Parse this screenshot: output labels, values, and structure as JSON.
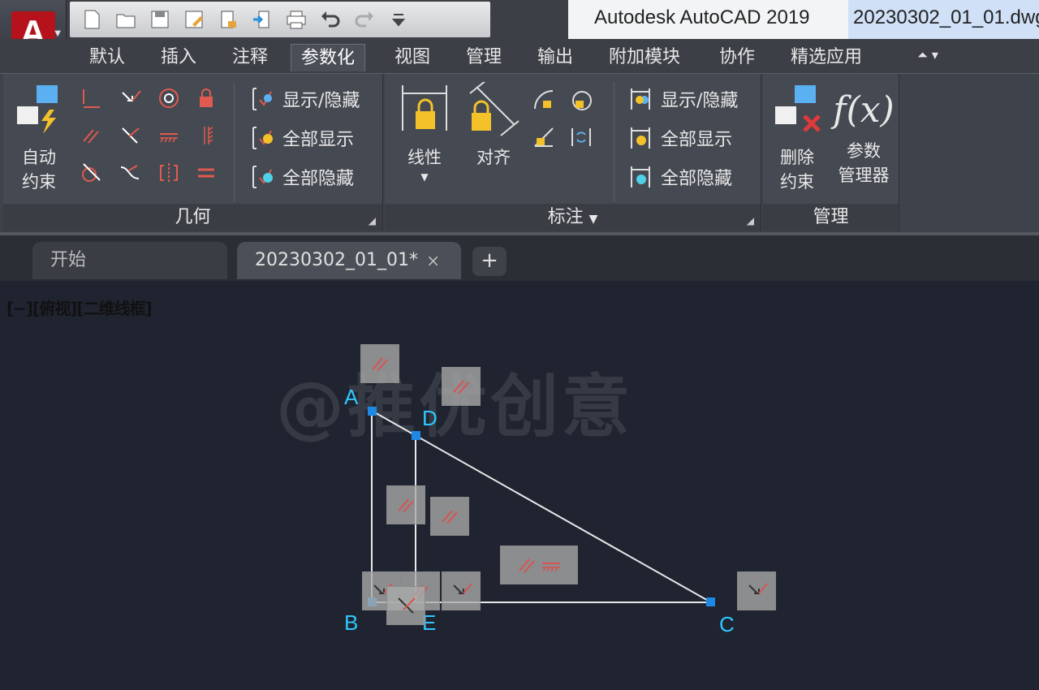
{
  "titlebar": {
    "app_title": "Autodesk AutoCAD 2019",
    "file_name": "20230302_01_01.dwg",
    "app_logo": "A"
  },
  "quick_access": [
    "new-icon",
    "open-icon",
    "save-icon",
    "save-as-icon",
    "open-from-cloud-icon",
    "share-icon",
    "plot-icon",
    "undo-icon",
    "redo-icon",
    "customize-qat-icon"
  ],
  "ribbon_tabs": [
    {
      "label": "默认"
    },
    {
      "label": "插入"
    },
    {
      "label": "注释"
    },
    {
      "label": "参数化",
      "active": true
    },
    {
      "label": "视图"
    },
    {
      "label": "管理"
    },
    {
      "label": "输出"
    },
    {
      "label": "附加模块"
    },
    {
      "label": "协作"
    },
    {
      "label": "精选应用"
    }
  ],
  "panels": {
    "geometry": {
      "title": "几何",
      "auto_constrain": [
        "自动",
        "约束"
      ],
      "show_hide": "显示/隐藏",
      "show_all": "全部显示",
      "hide_all": "全部隐藏"
    },
    "dimension": {
      "title": "标注",
      "linear": "线性",
      "aligned": "对齐",
      "show_hide": "显示/隐藏",
      "show_all": "全部显示",
      "hide_all": "全部隐藏"
    },
    "manage": {
      "title": "管理",
      "delete_constraints": [
        "删除",
        "约束"
      ],
      "parameters": [
        "参数",
        "管理器"
      ]
    }
  },
  "doc_tabs": {
    "start": "开始",
    "active": "20230302_01_01*",
    "close": "×",
    "new": "+"
  },
  "viewport": {
    "label": "[−][俯视][二维线框]"
  },
  "drawing": {
    "points": [
      "A",
      "B",
      "C",
      "D",
      "E"
    ],
    "watermark": "@推优创意"
  },
  "colors": {
    "canvas": "#1f2430",
    "point_label": "#2fc8ff",
    "grip": "#1e88e5",
    "constraint_red": "#d9534f"
  }
}
